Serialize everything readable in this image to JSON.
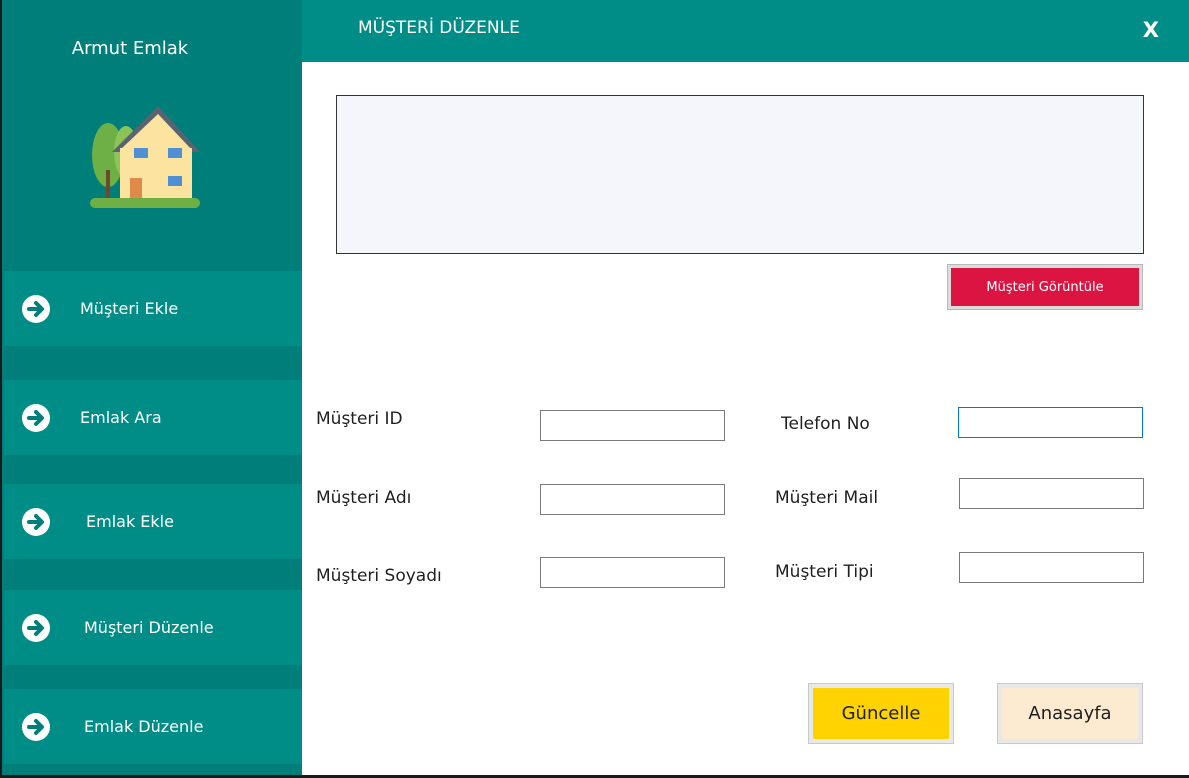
{
  "sidebar": {
    "brand": "Armut Emlak",
    "items": [
      {
        "label": "Müşteri Ekle"
      },
      {
        "label": "Emlak Ara"
      },
      {
        "label": "Emlak Ekle"
      },
      {
        "label": "Müşteri Düzenle"
      },
      {
        "label": "Emlak Düzenle"
      }
    ]
  },
  "header": {
    "title": "MÜŞTERİ DÜZENLE",
    "close_label": "X"
  },
  "main": {
    "view_button": "Müşteri Görüntüle",
    "fields": {
      "customer_id": {
        "label": "Müşteri ID",
        "value": ""
      },
      "customer_name": {
        "label": "Müşteri Adı",
        "value": ""
      },
      "customer_surname": {
        "label": "Müşteri Soyadı",
        "value": ""
      },
      "phone": {
        "label": "Telefon No",
        "value": ""
      },
      "mail": {
        "label": "Müşteri Mail",
        "value": ""
      },
      "type": {
        "label": "Müşteri Tipi",
        "value": ""
      }
    },
    "update_button": "Güncelle",
    "home_button": "Anasayfa"
  },
  "colors": {
    "sidebar_bg": "#007f7a",
    "sidebar_item_bg": "#008d87",
    "header_bg": "#008d87",
    "view_button_bg": "#dc1442",
    "update_button_bg": "#ffd200",
    "home_button_bg": "#fdebd1"
  },
  "icons": {
    "logo": "house-icon",
    "nav": "arrow-right-circle-icon",
    "close": "close-icon"
  }
}
